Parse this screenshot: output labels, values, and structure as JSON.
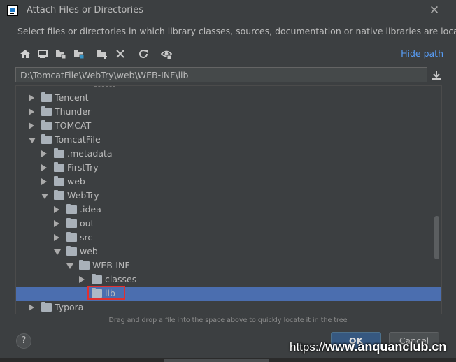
{
  "window": {
    "title": "Attach Files or Directories",
    "close_glyph": "✕"
  },
  "subtitle": "Select files or directories in which library classes, sources, documentation or native libraries are located",
  "toolbar": {
    "icons": [
      "home-icon",
      "desktop-icon",
      "project-folder-icon",
      "module-folder-icon",
      "new-folder-icon",
      "delete-icon",
      "refresh-icon",
      "show-hidden-icon"
    ],
    "hide_path_label": "Hide path"
  },
  "path": {
    "value": "D:\\TomcatFile\\WebTry\\web\\WEB-INF\\lib"
  },
  "tree": {
    "rows": [
      {
        "label": "Tencent",
        "depth": 0,
        "state": "collapsed",
        "selected": false
      },
      {
        "label": "Thunder",
        "depth": 0,
        "state": "collapsed",
        "selected": false
      },
      {
        "label": "TOMCAT",
        "depth": 0,
        "state": "collapsed",
        "selected": false
      },
      {
        "label": "TomcatFile",
        "depth": 0,
        "state": "expanded",
        "selected": false
      },
      {
        "label": ".metadata",
        "depth": 1,
        "state": "collapsed",
        "selected": false
      },
      {
        "label": "FirstTry",
        "depth": 1,
        "state": "collapsed",
        "selected": false
      },
      {
        "label": "web",
        "depth": 1,
        "state": "collapsed",
        "selected": false
      },
      {
        "label": "WebTry",
        "depth": 1,
        "state": "expanded",
        "selected": false
      },
      {
        "label": ".idea",
        "depth": 2,
        "state": "collapsed",
        "selected": false
      },
      {
        "label": "out",
        "depth": 2,
        "state": "collapsed",
        "selected": false
      },
      {
        "label": "src",
        "depth": 2,
        "state": "collapsed",
        "selected": false
      },
      {
        "label": "web",
        "depth": 2,
        "state": "expanded",
        "selected": false
      },
      {
        "label": "WEB-INF",
        "depth": 3,
        "state": "expanded",
        "selected": false
      },
      {
        "label": "classes",
        "depth": 4,
        "state": "collapsed",
        "selected": false
      },
      {
        "label": "lib",
        "depth": 4,
        "state": "leaf",
        "selected": true
      },
      {
        "label": "Typora",
        "depth": 0,
        "state": "collapsed",
        "selected": false
      }
    ]
  },
  "hint": "Drag and drop a file into the space above to quickly locate it in the tree",
  "buttons": {
    "help": "?",
    "ok": "OK",
    "cancel": "Cancel"
  },
  "watermark": {
    "prefix": "https://",
    "domain": "www.anquanclub.cn"
  },
  "colors": {
    "background": "#3c3f41",
    "selection": "#4b6eaf",
    "link": "#589df6",
    "highlight_box": "#e03030"
  }
}
